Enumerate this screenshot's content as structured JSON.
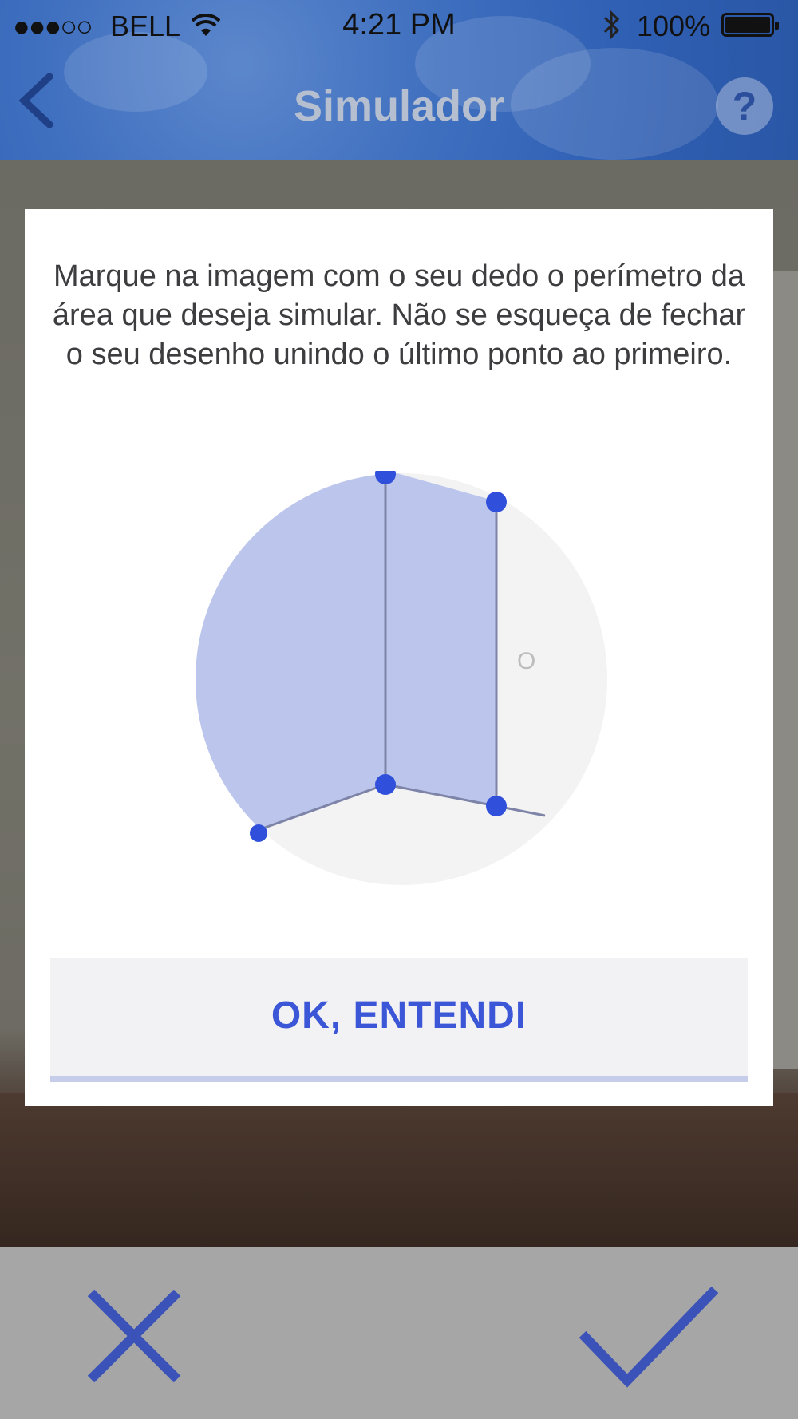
{
  "status_bar": {
    "signal": "●●●○○",
    "carrier": "BELL",
    "time": "4:21 PM",
    "battery": "100%",
    "icons": [
      "wifi-icon",
      "bluetooth-icon",
      "battery-icon"
    ]
  },
  "nav": {
    "title": "Simulador",
    "back_icon": "chevron-left-icon",
    "help_label": "?"
  },
  "modal": {
    "instruction": "Marque na imagem com o seu dedo o perímetro da área que deseja simular. Não se esqueça de fechar o seu desenho unindo o último ponto ao primeiro.",
    "illustration_marker": "O",
    "button_label": "OK, ENTENDI"
  },
  "bottom_bar": {
    "cancel_icon": "close-icon",
    "confirm_icon": "checkmark-icon"
  },
  "colors": {
    "accent": "#3b56d6",
    "nav_blue": "#3f6fbf",
    "fill_blue": "#bcc5ec",
    "bottom_bar": "#a6a6a7"
  }
}
